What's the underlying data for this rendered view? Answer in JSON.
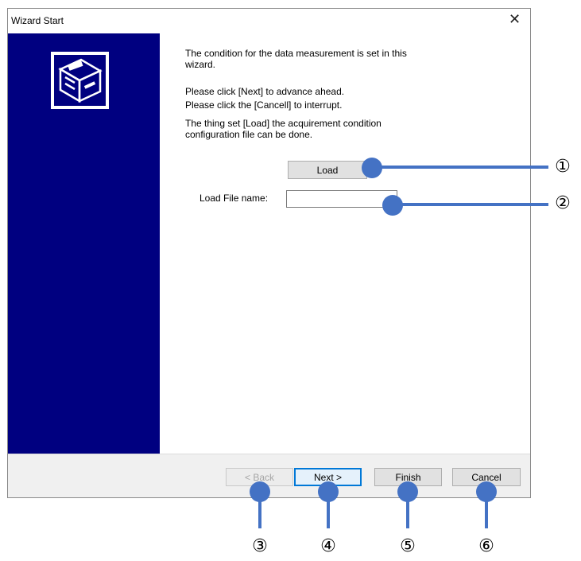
{
  "window": {
    "title": "Wizard Start",
    "close_glyph": "✕"
  },
  "sidebar": {
    "logo_icon": "wizard-disk-drive-icon",
    "background_color": "#000080"
  },
  "content": {
    "paragraph1_line1": "The condition for the data measurement is set in this",
    "paragraph1_line2": "wizard.",
    "paragraph2": "Please click [Next] to advance ahead.",
    "paragraph3": "Please click the [Cancell] to interrupt.",
    "paragraph4_line1": "The thing set [Load] the acquirement condition",
    "paragraph4_line2": "configuration file can be done.",
    "load_button": "Load",
    "load_file_label": "Load File name:",
    "load_file_value": ""
  },
  "footer": {
    "back_button": "< Back",
    "next_button": "Next >",
    "finish_button": "Finish",
    "cancel_button": "Cancel"
  },
  "callouts": {
    "color": "#4472c4",
    "load": "①",
    "file_name": "②",
    "back": "③",
    "next": "④",
    "finish": "⑤",
    "cancel": "⑥"
  }
}
